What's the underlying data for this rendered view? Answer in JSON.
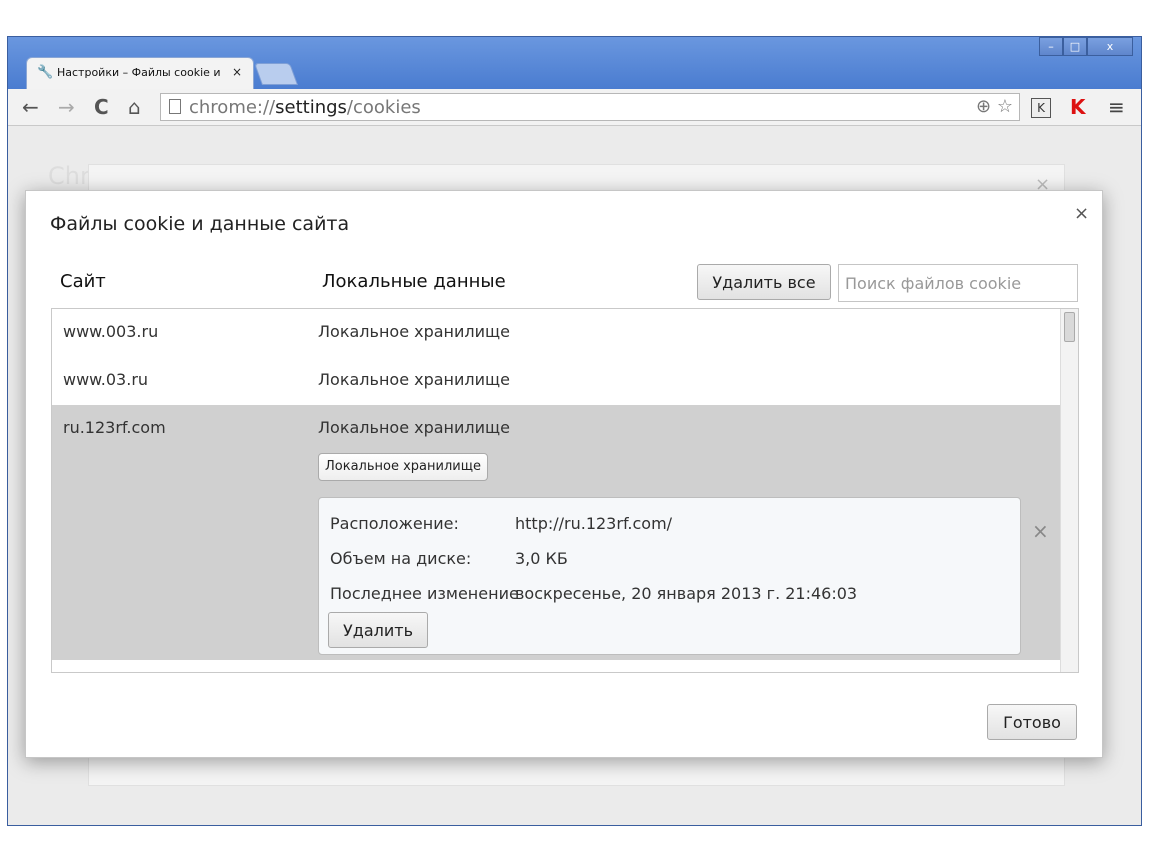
{
  "browser": {
    "tab_title": "Настройки – Файлы cookie и",
    "tab_close": "×",
    "url_scheme": "chrome://",
    "url_host": "settings",
    "url_path": "/cookies",
    "extension_k": "K",
    "window_minimize": "–",
    "window_maximize": "□",
    "window_close": "x"
  },
  "background": {
    "title": "Chr",
    "close": "×"
  },
  "dialog": {
    "title": "Файлы cookie и данные сайта",
    "close": "×",
    "col_site": "Сайт",
    "col_local": "Локальные данные",
    "delete_all_label": "Удалить все",
    "search_placeholder": "Поиск файлов cookie",
    "rows": [
      {
        "site": "www.003.ru",
        "data": "Локальное хранилище"
      },
      {
        "site": "www.03.ru",
        "data": "Локальное хранилище"
      },
      {
        "site": "ru.123rf.com",
        "data": "Локальное хранилище"
      }
    ],
    "chip_label": "Локальное хранилище",
    "detail": {
      "location_label": "Расположение:",
      "location_value": "http://ru.123rf.com/",
      "size_label": "Объем на диске:",
      "size_value": "3,0 КБ",
      "modified_label": "Последнее изменение",
      "modified_value": "воскресенье, 20 января 2013 г. 21:46:03",
      "delete_label": "Удалить"
    },
    "row_remove": "×",
    "done_label": "Готово"
  }
}
